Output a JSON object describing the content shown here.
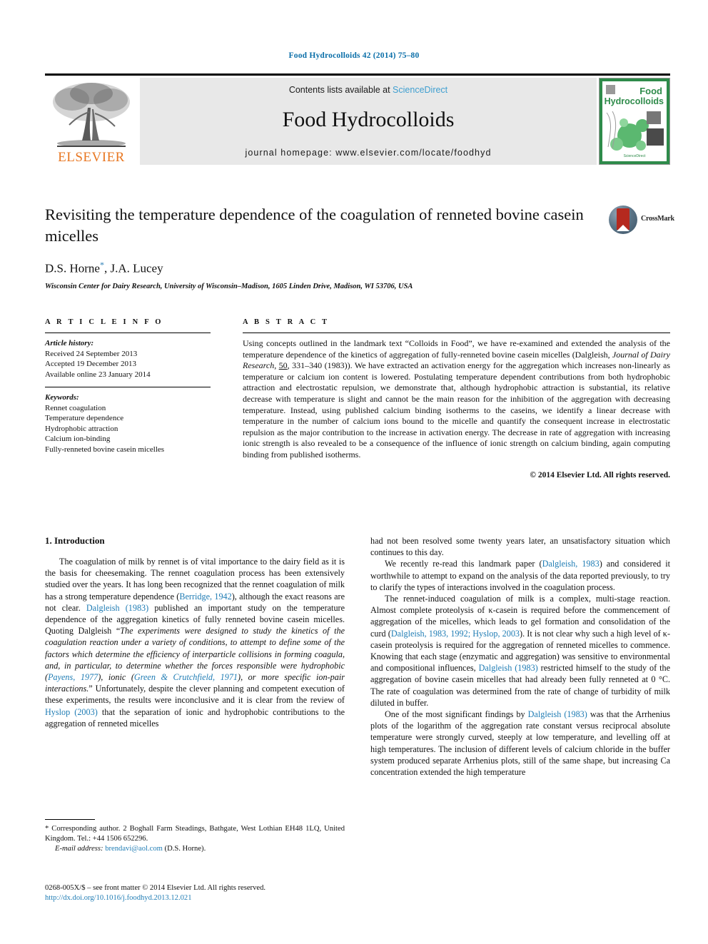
{
  "running_head": "Food Hydrocolloids 42 (2014) 75–80",
  "masthead": {
    "publisher_name": "ELSEVIER",
    "contents_prefix": "Contents lists available at ",
    "contents_link": "ScienceDirect",
    "journal_title": "Food Hydrocolloids",
    "homepage_line": "journal homepage: www.elsevier.com/locate/foodhyd",
    "cover_title_line1": "Food",
    "cover_title_line2": "Hydrocolloids",
    "cover_footer": "ScienceDirect"
  },
  "article": {
    "title": "Revisiting the temperature dependence of the coagulation of renneted bovine casein micelles",
    "authors": "D.S. Horne",
    "authors_rest": ", J.A. Lucey",
    "affiliation": "Wisconsin Center for Dairy Research, University of Wisconsin–Madison, 1605 Linden Drive, Madison, WI 53706, USA",
    "crossmark_label": "CrossMark"
  },
  "info": {
    "heading": "A R T I C L E   I N F O",
    "history_label": "Article history:",
    "history": [
      "Received 24 September 2013",
      "Accepted 19 December 2013",
      "Available online 23 January 2014"
    ],
    "keywords_label": "Keywords:",
    "keywords": [
      "Rennet coagulation",
      "Temperature dependence",
      "Hydrophobic attraction",
      "Calcium ion-binding",
      "Fully-renneted bovine casein micelles"
    ]
  },
  "abstract": {
    "heading": "A B S T R A C T",
    "part1": "Using concepts outlined in the landmark text “Colloids in Food”, we have re-examined and extended the analysis of the temperature dependence of the kinetics of aggregation of fully-renneted bovine casein micelles (Dalgleish, ",
    "journal_italic": "Journal of Dairy Research",
    "part2_sep": ", ",
    "volume": "50",
    "part3": ", 331–340 (1983)). We have extracted an activation energy for the aggregation which increases non-linearly as temperature or calcium ion content is lowered. Postulating temperature dependent contributions from both hydrophobic attraction and electrostatic repulsion, we demonstrate that, although hydrophobic attraction is substantial, its relative decrease with temperature is slight and cannot be the main reason for the inhibition of the aggregation with decreasing temperature. Instead, using published calcium binding isotherms to the caseins, we identify a linear decrease with temperature in the number of calcium ions bound to the micelle and quantify the consequent increase in electrostatic repulsion as the major contribution to the increase in activation energy. The decrease in rate of aggregation with increasing ionic strength is also revealed to be a consequence of the influence of ionic strength on calcium binding, again computing binding from published isotherms.",
    "copyright": "© 2014 Elsevier Ltd. All rights reserved."
  },
  "body": {
    "section_number_title": "1. Introduction",
    "left": {
      "p1_a": "The coagulation of milk by rennet is of vital importance to the dairy field as it is the basis for cheesemaking. The rennet coagulation process has been extensively studied over the years. It has long been recognized that the rennet coagulation of milk has a strong temperature dependence (",
      "p1_ref1": "Berridge, 1942",
      "p1_b": "), although the exact reasons are not clear. ",
      "p1_ref2": "Dalgleish (1983)",
      "p1_c": " published an important study on the temperature dependence of the aggregation kinetics of fully renneted bovine casein micelles. Quoting Dalgleish “",
      "p1_quote1": "The experiments were designed to study the kinetics of the coagulation reaction under a variety of conditions, to attempt to define some of the factors which determine the efficiency of interparticle collisions in forming coagula, and, in particular, to determine whether the forces responsible were hydrophobic (",
      "p1_ref3": "Payens, 1977",
      "p1_quote2": "), ionic (",
      "p1_ref4": "Green & Crutchfield, 1971",
      "p1_quote3": "), or more specific ion-pair interactions.",
      "p1_d": "” Unfortunately, despite the clever planning and competent execution of these experiments, the results were inconclusive and it is clear from the review of ",
      "p1_ref5": "Hyslop (2003)",
      "p1_e": " that the separation of ionic and hydrophobic contributions to the aggregation of renneted micelles"
    },
    "right": {
      "p1_cont": "had not been resolved some twenty years later, an unsatisfactory situation which continues to this day.",
      "p2_a": "We recently re-read this landmark paper (",
      "p2_ref1": "Dalgleish, 1983",
      "p2_b": ") and considered it worthwhile to attempt to expand on the analysis of the data reported previously, to try to clarify the types of interactions involved in the coagulation process.",
      "p3_a": "The rennet-induced coagulation of milk is a complex, multi-stage reaction. Almost complete proteolysis of κ-casein is required before the commencement of aggregation of the micelles, which leads to gel formation and consolidation of the curd (",
      "p3_ref1": "Dalgleish, 1983, 1992; Hyslop, 2003",
      "p3_b": "). It is not clear why such a high level of κ-casein proteolysis is required for the aggregation of renneted micelles to commence. Knowing that each stage (enzymatic and aggregation) was sensitive to environmental and compositional influences, ",
      "p3_ref2": "Dalgleish (1983)",
      "p3_c": " restricted himself to the study of the aggregation of bovine casein micelles that had already been fully renneted at 0 °C. The rate of coagulation was determined from the rate of change of turbidity of milk diluted in buffer.",
      "p4_a": "One of the most significant findings by ",
      "p4_ref1": "Dalgleish (1983)",
      "p4_b": " was that the Arrhenius plots of the logarithm of the aggregation rate constant versus reciprocal absolute temperature were strongly curved, steeply at low temperature, and levelling off at high temperatures. The inclusion of different levels of calcium chloride in the buffer system produced separate Arrhenius plots, still of the same shape, but increasing Ca concentration extended the high temperature"
    }
  },
  "footnote": {
    "corresponding": "* Corresponding author. 2 Boghall Farm Steadings, Bathgate, West Lothian EH48 1LQ, United Kingdom. Tel.: +44 1506 652296.",
    "email_label": "E-mail address:",
    "email": "brendavi@aol.com",
    "email_owner": "(D.S. Horne)."
  },
  "imprint": {
    "line1": "0268-005X/$ – see front matter © 2014 Elsevier Ltd. All rights reserved.",
    "doi": "http://dx.doi.org/10.1016/j.foodhyd.2013.12.021"
  },
  "colors": {
    "link": "#1f7cb4",
    "running_head": "#0a6ea8",
    "elsevier_orange": "#e87722",
    "masthead_bg": "#e8e8e8",
    "cover_green": "#2e8b4a"
  }
}
